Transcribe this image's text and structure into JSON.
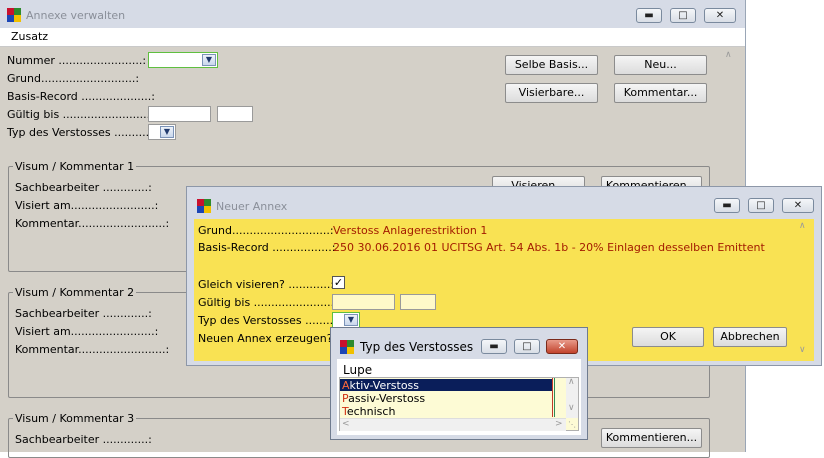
{
  "main": {
    "title": "Annexe verwalten",
    "menu": [
      "Zusatz"
    ],
    "labels": {
      "nummer": "Nummer ........................:",
      "grund": "Grund...........................:",
      "basis_record": "Basis-Record ....................:",
      "gueltig_bis": "Gültig bis .........................:",
      "typ": "Typ des Verstosses ............:"
    },
    "buttons": {
      "selbe_basis": "Selbe Basis...",
      "neu": "Neu...",
      "visierbare": "Visierbare...",
      "kommentar": "Kommentar..."
    },
    "groups": [
      {
        "title": "Visum / Kommentar 1",
        "sachbearbeiter": "Sachbearbeiter .............:",
        "visiert_am": "Visiert am........................:",
        "kommentar": "Kommentar.........................:",
        "visieren": "Visieren...",
        "kommentieren": "Kommentieren..."
      },
      {
        "title": "Visum / Kommentar 2",
        "sachbearbeiter": "Sachbearbeiter .............:",
        "visiert_am": "Visiert am........................:",
        "kommentar": "Kommentar.........................:"
      },
      {
        "title": "Visum / Kommentar 3",
        "sachbearbeiter": "Sachbearbeiter .............:",
        "kommentieren": "Kommentieren..."
      }
    ]
  },
  "dialog": {
    "title": "Neuer Annex",
    "labels": {
      "grund": "Grund............................:",
      "basis_record": "Basis-Record .................:",
      "gleich_visieren": "Gleich visieren? ............:",
      "gueltig_bis": "Gültig bis .......................:",
      "typ": "Typ des Verstosses .........:",
      "neuen_annex": "Neuen Annex erzeugen? .:"
    },
    "values": {
      "grund": "Verstoss Anlagerestriktion 1",
      "basis_record": "250 30.06.2016 01 UCITSG Art. 54 Abs. 1b - 20% Einlagen desselben Emittent"
    },
    "buttons": {
      "ok": "OK",
      "abbrechen": "Abbrechen"
    },
    "checkbox_checked": true
  },
  "popup": {
    "title": "Typ des Verstosses",
    "header": "Lupe",
    "items": [
      {
        "label": "Aktiv-Verstoss",
        "initial": "A",
        "rest": "ktiv-Verstoss",
        "selected": true
      },
      {
        "label": "Passiv-Verstoss",
        "initial": "P",
        "rest": "assiv-Verstoss",
        "selected": false
      },
      {
        "label": "Technisch",
        "initial": "T",
        "rest": "echnisch",
        "selected": false
      }
    ]
  },
  "colors": {
    "dialog_bg": "#f9e253",
    "dialog_value": "#a31b00",
    "popup_item_bg": "#fdfbd5",
    "selected_bg": "#0a1e5a",
    "window_bg": "#d4d0c8"
  },
  "icons": [
    "app-logo-icon",
    "minimize-icon",
    "maximize-icon",
    "close-icon",
    "chevron-down-icon",
    "checkmark-icon",
    "scroll-up-icon",
    "scroll-down-icon",
    "resize-grip-icon"
  ]
}
